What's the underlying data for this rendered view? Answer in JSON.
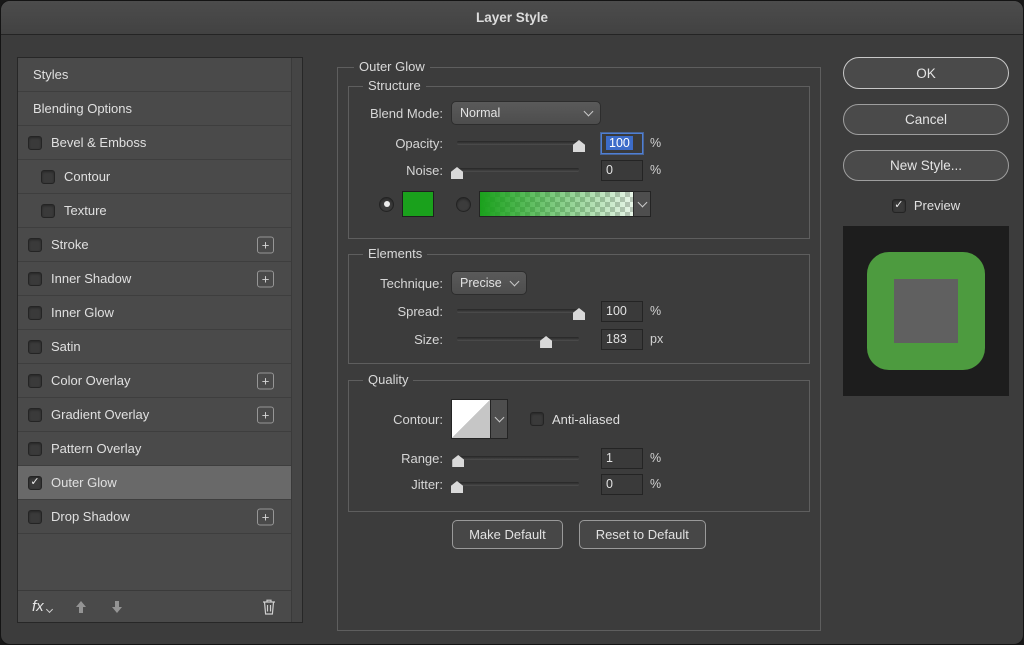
{
  "title": "Layer Style",
  "colors": {
    "glow_swatch": "#1aa11c",
    "selection": "#3c6cc9",
    "preview_bg": "#1d1d1d",
    "preview_ring": "#4d9b3f",
    "preview_inner": "#606060"
  },
  "icons": {
    "check": "✓",
    "plus": "+",
    "chevron_down": "css-chevron",
    "up_arrow": "svg-arrow-up",
    "down_arrow": "svg-arrow-down",
    "trash": "svg-trash",
    "fx_menu_caret": "css-chevron"
  },
  "sidebar": {
    "items": [
      {
        "label": "Styles",
        "has_checkbox": false
      },
      {
        "label": "Blending Options",
        "has_checkbox": false
      },
      {
        "label": "Bevel & Emboss",
        "has_checkbox": true,
        "checked": false
      },
      {
        "label": "Contour",
        "has_checkbox": true,
        "checked": false,
        "indented": true
      },
      {
        "label": "Texture",
        "has_checkbox": true,
        "checked": false,
        "indented": true
      },
      {
        "label": "Stroke",
        "has_checkbox": true,
        "checked": false,
        "has_add_button": true
      },
      {
        "label": "Inner Shadow",
        "has_checkbox": true,
        "checked": false,
        "has_add_button": true
      },
      {
        "label": "Inner Glow",
        "has_checkbox": true,
        "checked": false
      },
      {
        "label": "Satin",
        "has_checkbox": true,
        "checked": false
      },
      {
        "label": "Color Overlay",
        "has_checkbox": true,
        "checked": false,
        "has_add_button": true
      },
      {
        "label": "Gradient Overlay",
        "has_checkbox": true,
        "checked": false,
        "has_add_button": true
      },
      {
        "label": "Pattern Overlay",
        "has_checkbox": true,
        "checked": false
      },
      {
        "label": "Outer Glow",
        "has_checkbox": true,
        "checked": true,
        "selected": true
      },
      {
        "label": "Drop Shadow",
        "has_checkbox": true,
        "checked": false,
        "has_add_button": true
      }
    ],
    "footer": {
      "fx_label": "fx"
    }
  },
  "main": {
    "panel_title": "Outer Glow",
    "structure": {
      "legend": "Structure",
      "blend_mode": {
        "label": "Blend Mode:",
        "value": "Normal"
      },
      "opacity": {
        "label": "Opacity:",
        "value": "100",
        "unit": "%",
        "pos": "100%",
        "value_selected": true
      },
      "noise": {
        "label": "Noise:",
        "value": "0",
        "unit": "%",
        "pos": "0%"
      },
      "glow_fill": {
        "color_radio_selected": true,
        "gradient_radio_selected": false
      }
    },
    "elements": {
      "legend": "Elements",
      "technique": {
        "label": "Technique:",
        "value": "Precise"
      },
      "spread": {
        "label": "Spread:",
        "value": "100",
        "unit": "%",
        "pos": "100%"
      },
      "size": {
        "label": "Size:",
        "value": "183",
        "unit": "px",
        "pos": "73%"
      }
    },
    "quality": {
      "legend": "Quality",
      "contour": {
        "label": "Contour:"
      },
      "anti_aliased": {
        "label": "Anti-aliased",
        "checked": false
      },
      "range": {
        "label": "Range:",
        "value": "1",
        "unit": "%",
        "pos": "1%"
      },
      "jitter": {
        "label": "Jitter:",
        "value": "0",
        "unit": "%",
        "pos": "0%"
      }
    },
    "footer_buttons": {
      "make_default": "Make Default",
      "reset_to_default": "Reset to Default"
    }
  },
  "actions": {
    "ok": "OK",
    "cancel": "Cancel",
    "new_style": "New Style...",
    "preview": {
      "label": "Preview",
      "checked": true
    }
  }
}
